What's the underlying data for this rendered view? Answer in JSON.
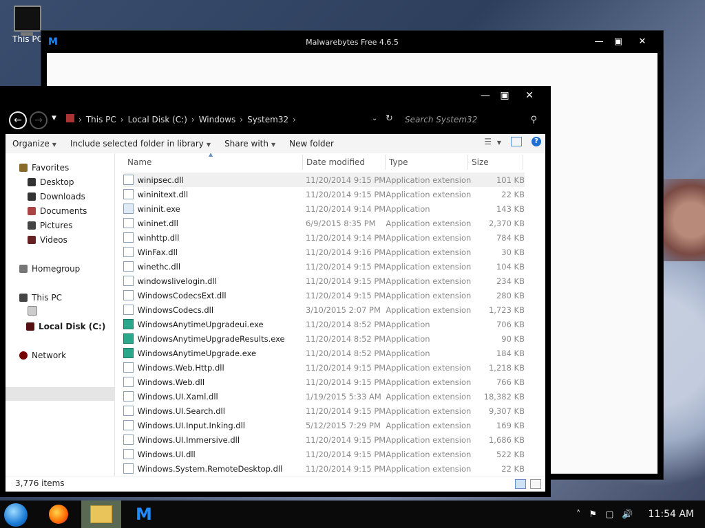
{
  "desktop": {
    "icon_label": "This PC"
  },
  "malwarebytes": {
    "title": "Malwarebytes Free  4.6.5"
  },
  "explorer": {
    "breadcrumbs": [
      "This PC",
      "Local Disk (C:)",
      "Windows",
      "System32"
    ],
    "search_placeholder": "Search System32",
    "toolbar": {
      "organize": "Organize",
      "include": "Include selected folder in library",
      "share": "Share with",
      "new_folder": "New folder"
    },
    "nav": {
      "favorites": "Favorites",
      "desktop": "Desktop",
      "downloads": "Downloads",
      "documents": "Documents",
      "pictures": "Pictures",
      "videos": "Videos",
      "homegroup": "Homegroup",
      "this_pc": "This PC",
      "local_disk": "Local Disk (C:)",
      "network": "Network"
    },
    "columns": {
      "name": "Name",
      "date": "Date modified",
      "type": "Type",
      "size": "Size"
    },
    "files": [
      {
        "name": "winipsec.dll",
        "date": "11/20/2014 9:15 PM",
        "type": "Application extension",
        "size": "101 KB",
        "icon": "dll"
      },
      {
        "name": "wininitext.dll",
        "date": "11/20/2014 9:15 PM",
        "type": "Application extension",
        "size": "22 KB",
        "icon": "dll"
      },
      {
        "name": "wininit.exe",
        "date": "11/20/2014 9:14 PM",
        "type": "Application",
        "size": "143 KB",
        "icon": "exe"
      },
      {
        "name": "wininet.dll",
        "date": "6/9/2015 8:35 PM",
        "type": "Application extension",
        "size": "2,370 KB",
        "icon": "dll"
      },
      {
        "name": "winhttp.dll",
        "date": "11/20/2014 9:14 PM",
        "type": "Application extension",
        "size": "784 KB",
        "icon": "dll"
      },
      {
        "name": "WinFax.dll",
        "date": "11/20/2014 9:16 PM",
        "type": "Application extension",
        "size": "30 KB",
        "icon": "dll"
      },
      {
        "name": "winethc.dll",
        "date": "11/20/2014 9:15 PM",
        "type": "Application extension",
        "size": "104 KB",
        "icon": "dll"
      },
      {
        "name": "windowslivelogin.dll",
        "date": "11/20/2014 9:15 PM",
        "type": "Application extension",
        "size": "234 KB",
        "icon": "dll"
      },
      {
        "name": "WindowsCodecsExt.dll",
        "date": "11/20/2014 9:15 PM",
        "type": "Application extension",
        "size": "280 KB",
        "icon": "dll"
      },
      {
        "name": "WindowsCodecs.dll",
        "date": "3/10/2015 2:07 PM",
        "type": "Application extension",
        "size": "1,723 KB",
        "icon": "dll"
      },
      {
        "name": "WindowsAnytimeUpgradeui.exe",
        "date": "11/20/2014 8:52 PM",
        "type": "Application",
        "size": "706 KB",
        "icon": "app2"
      },
      {
        "name": "WindowsAnytimeUpgradeResults.exe",
        "date": "11/20/2014 8:52 PM",
        "type": "Application",
        "size": "90 KB",
        "icon": "app2"
      },
      {
        "name": "WindowsAnytimeUpgrade.exe",
        "date": "11/20/2014 8:52 PM",
        "type": "Application",
        "size": "184 KB",
        "icon": "app2"
      },
      {
        "name": "Windows.Web.Http.dll",
        "date": "11/20/2014 9:15 PM",
        "type": "Application extension",
        "size": "1,218 KB",
        "icon": "dll"
      },
      {
        "name": "Windows.Web.dll",
        "date": "11/20/2014 9:15 PM",
        "type": "Application extension",
        "size": "766 KB",
        "icon": "dll"
      },
      {
        "name": "Windows.UI.Xaml.dll",
        "date": "1/19/2015 5:33 AM",
        "type": "Application extension",
        "size": "18,382 KB",
        "icon": "dll"
      },
      {
        "name": "Windows.UI.Search.dll",
        "date": "11/20/2014 9:15 PM",
        "type": "Application extension",
        "size": "9,307 KB",
        "icon": "dll"
      },
      {
        "name": "Windows.UI.Input.Inking.dll",
        "date": "5/12/2015 7:29 PM",
        "type": "Application extension",
        "size": "169 KB",
        "icon": "dll"
      },
      {
        "name": "Windows.UI.Immersive.dll",
        "date": "11/20/2014 9:15 PM",
        "type": "Application extension",
        "size": "1,686 KB",
        "icon": "dll"
      },
      {
        "name": "Windows.UI.dll",
        "date": "11/20/2014 9:15 PM",
        "type": "Application extension",
        "size": "522 KB",
        "icon": "dll"
      },
      {
        "name": "Windows.System.RemoteDesktop.dll",
        "date": "11/20/2014 9:15 PM",
        "type": "Application extension",
        "size": "22 KB",
        "icon": "dll"
      }
    ],
    "status": {
      "count": "3,776 items"
    }
  },
  "taskbar": {
    "clock": "11:54 AM"
  }
}
